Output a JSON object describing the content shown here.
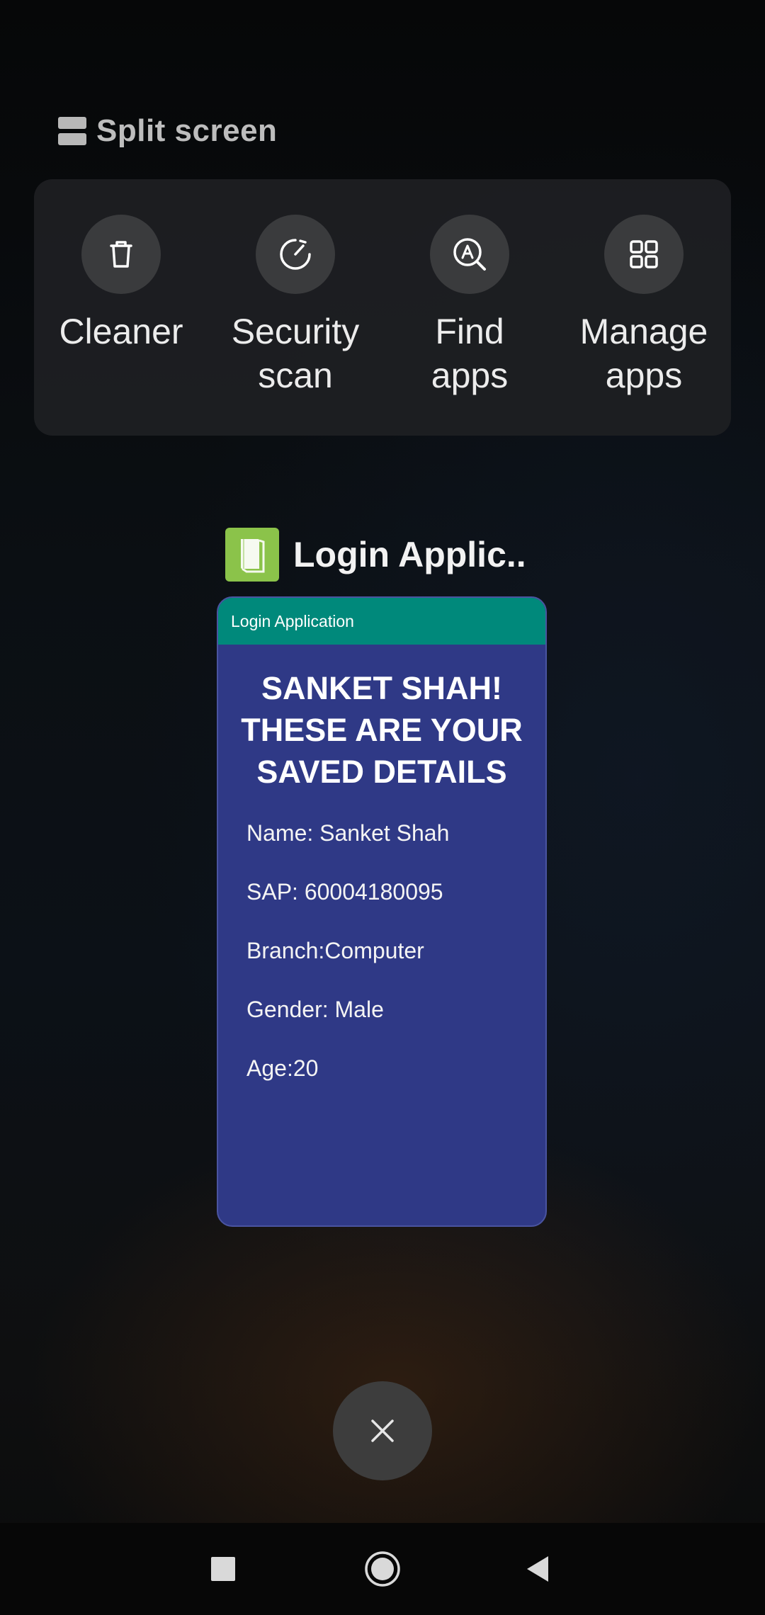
{
  "split_screen": {
    "label": "Split screen",
    "icon": "split-screen-icon"
  },
  "tools": [
    {
      "label": "Cleaner",
      "icon": "trash-icon"
    },
    {
      "label": "Security\nscan",
      "icon": "gauge-icon"
    },
    {
      "label": "Find\napps",
      "icon": "app-search-icon"
    },
    {
      "label": "Manage\napps",
      "icon": "grid-icon"
    }
  ],
  "recent_app": {
    "title": "Login Applic..",
    "icon": "book-icon",
    "icon_color": "#8bc34a",
    "toolbar_title": "Login Application",
    "toolbar_color": "#00897b",
    "background_color": "#2f3986",
    "heading": "SANKET SHAH!\nTHESE ARE YOUR\nSAVED DETAILS",
    "details": {
      "name": "Name: Sanket Shah",
      "sap": "SAP: 60004180095",
      "branch": "Branch:Computer",
      "gender": "Gender: Male",
      "age": "Age:20"
    }
  },
  "close_button": {
    "icon": "close-icon"
  },
  "nav": {
    "recents": "square-icon",
    "home": "circle-icon",
    "back": "triangle-back-icon"
  }
}
